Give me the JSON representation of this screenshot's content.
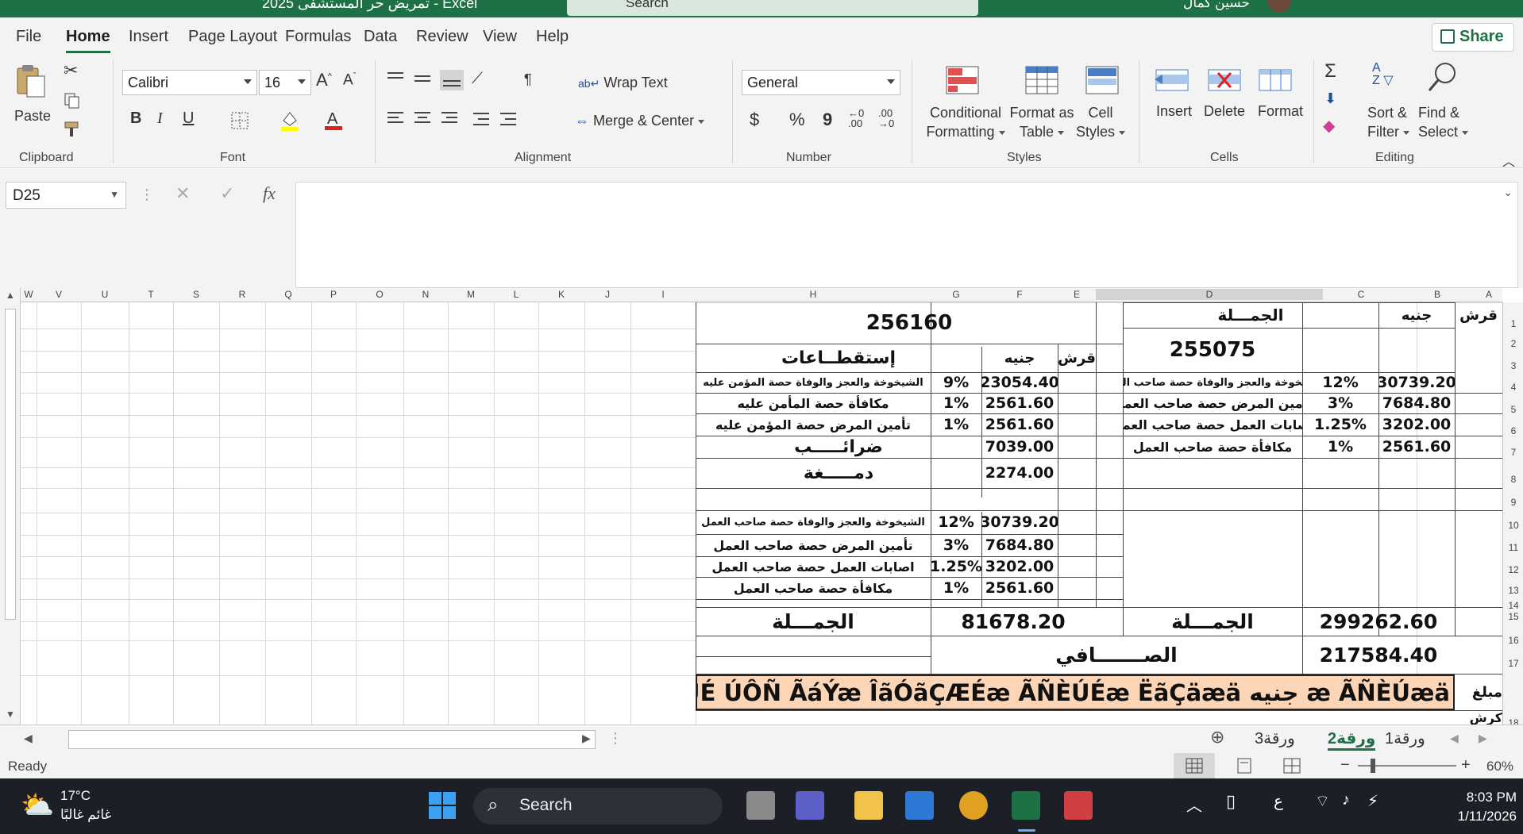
{
  "titlebar": {
    "title": "تمريض حر المستشفى 2025  -  Excel",
    "search_placeholder": "Search",
    "user_name": "حسين كمال"
  },
  "menu": {
    "tabs": [
      "File",
      "Home",
      "Insert",
      "Page Layout",
      "Formulas",
      "Data",
      "Review",
      "View",
      "Help"
    ],
    "active_tab": "Home",
    "share_label": "Share"
  },
  "ribbon": {
    "clipboard": {
      "label": "Clipboard",
      "paste": "Paste"
    },
    "font": {
      "label": "Font",
      "font_name": "Calibri",
      "font_size": "16",
      "bold": "B",
      "italic": "I",
      "underline": "U"
    },
    "alignment": {
      "label": "Alignment",
      "wrap_text": "Wrap Text",
      "merge_center": "Merge & Center"
    },
    "number": {
      "label": "Number",
      "format": "General",
      "currency": "$",
      "percent": "%",
      "comma": "9"
    },
    "styles": {
      "label": "Styles",
      "conditional_1": "Conditional",
      "conditional_2": "Formatting",
      "format_table_1": "Format as",
      "format_table_2": "Table",
      "cell_styles_1": "Cell",
      "cell_styles_2": "Styles"
    },
    "cells": {
      "label": "Cells",
      "insert": "Insert",
      "delete": "Delete",
      "format": "Format"
    },
    "editing": {
      "label": "Editing",
      "sort_1": "Sort &",
      "sort_2": "Filter",
      "find_1": "Find &",
      "find_2": "Select"
    }
  },
  "formula_bar": {
    "name_box": "D25",
    "fx": "fx",
    "value": ""
  },
  "columns": [
    "W",
    "V",
    "U",
    "T",
    "S",
    "R",
    "Q",
    "P",
    "O",
    "N",
    "M",
    "L",
    "K",
    "J",
    "I",
    "H",
    "G",
    "F",
    "E",
    "D",
    "C",
    "B",
    "A"
  ],
  "rows": [
    "1",
    "2",
    "3",
    "4",
    "5",
    "6",
    "7",
    "8",
    "9",
    "10",
    "11",
    "12",
    "13",
    "14",
    "15",
    "16",
    "17",
    "18"
  ],
  "sheet": {
    "r1_a": "قرش",
    "r1_b": "جنيه",
    "r1_d": "الجمـــلة",
    "r1_h": "256160",
    "r2_d": "255075",
    "r3_e": "قرش",
    "r3_f": "جنيه",
    "r3_h": "إستقطــاعات",
    "r4_b": "30739.20",
    "r4_c": "12%",
    "r4_d": "الشيخوخة والعجز والوفاة حصة صاحب العمل",
    "r4_f": "23054.40",
    "r4_g": "9%",
    "r4_h": "الشيخوخة والعجز والوفاة حصة المؤمن عليه",
    "r5_b": "7684.80",
    "r5_c": "3%",
    "r5_d": "تأمين المرض حصة صاحب العمل",
    "r5_f": "2561.60",
    "r5_g": "1%",
    "r5_h": "مكافأة حصة المأمن عليه",
    "r6_b": "3202.00",
    "r6_c": "1.25%",
    "r6_d": "اصابات العمل حصة صاحب العمل",
    "r6_f": "2561.60",
    "r6_g": "1%",
    "r6_h": "تأمين المرض حصة المؤمن عليه",
    "r7_b": "2561.60",
    "r7_c": "1%",
    "r7_d": "مكافأة حصة صاحب العمل",
    "r7_f": "7039.00",
    "r7_h": "ضرائـــــب",
    "r8_f": "2274.00",
    "r8_h": "دمـــــغة",
    "r10_f": "30739.20",
    "r10_g": "12%",
    "r10_h": "الشيخوخة والعجز والوفاة حصة صاحب العمل",
    "r11_f": "7684.80",
    "r11_g": "3%",
    "r11_h": "تأمين المرض حصة صاحب العمل",
    "r12_f": "3202.00",
    "r12_g": "1.25%",
    "r12_h": "اصابات العمل حصة صاحب العمل",
    "r13_f": "2561.60",
    "r13_g": "1%",
    "r13_h": "مكافأة حصة صاحب العمل",
    "r14_b": "299262.60",
    "r14_d": "الجمـــلة",
    "r14_fg": "81678.20",
    "r14_h": "الجمـــلة",
    "r16_b": "217584.40",
    "r16_d": "الصـــــــافي",
    "r18_a": "مبلغ",
    "r18_text": "ÇÆÊÇäæ ÓÈÚÉ ÚÔÑ ÃáÝæ ÎãÓãÇÆÉæ ÃÑÈÚÉæ ËãÇäæä جنيه æ ÃÑÈÚæä",
    "r19_a": "كرش"
  },
  "sheet_tabs": [
    "ورقة1",
    "ورقة2",
    "ورقة3"
  ],
  "active_sheet": "ورقة2",
  "status": {
    "ready": "Ready",
    "zoom": "60%"
  },
  "taskbar": {
    "temp": "17°C",
    "weather": "غائم غالبًا",
    "search": "Search",
    "time": "8:03 PM",
    "date": "1/11/2026",
    "lang": "ع"
  },
  "colors": {
    "excel_green": "#1e7145",
    "orange_fill": "#fbd5b5"
  }
}
